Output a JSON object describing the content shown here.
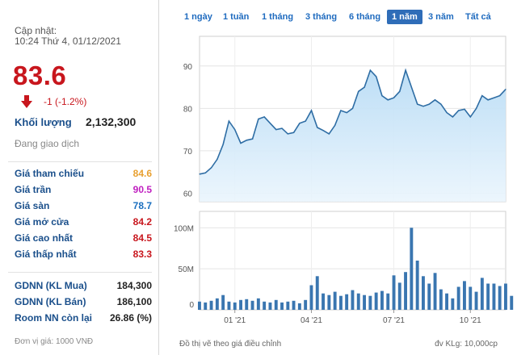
{
  "summary": {
    "updated_label": "Cập nhật:",
    "updated_time": "10:24 Thứ 4, 01/12/2021",
    "price": "83.6",
    "change": "-1 (-1.2%)",
    "volume_label": "Khối lượng",
    "volume_value": "2,132,300",
    "status": "Đang giao dịch",
    "down_color": "#c8161d"
  },
  "stats": [
    {
      "label": "Giá tham chiếu",
      "value": "84.6",
      "color": "#e8a030"
    },
    {
      "label": "Giá trần",
      "value": "90.5",
      "color": "#c020c0"
    },
    {
      "label": "Giá sàn",
      "value": "78.7",
      "color": "#1a6fbf"
    },
    {
      "label": "Giá mở cửa",
      "value": "84.2",
      "color": "#c8161d"
    },
    {
      "label": "Giá cao nhất",
      "value": "84.5",
      "color": "#c8161d"
    },
    {
      "label": "Giá thấp nhất",
      "value": "83.3",
      "color": "#c8161d"
    }
  ],
  "foreign": [
    {
      "label": "GDNN (KL Mua)",
      "value": "184,300"
    },
    {
      "label": "GDNN (KL Bán)",
      "value": "186,100"
    },
    {
      "label": "Room NN còn lại",
      "value": "26.86 (%)"
    }
  ],
  "unit_note": "Đơn vị giá: 1000 VNĐ",
  "periods": [
    "1 ngày",
    "1 tuần",
    "1 tháng",
    "3 tháng",
    "6 tháng",
    "1 năm",
    "3 năm",
    "Tất cả"
  ],
  "active_period": "1 năm",
  "footer": {
    "left": "Đồ thị vẽ theo giá điều chỉnh",
    "right": "đv KLg: 10,000cp"
  },
  "chart_data": [
    {
      "type": "area",
      "y_ticks": [
        "90",
        "80",
        "70",
        "60"
      ],
      "y_values": [
        90,
        80,
        70,
        60
      ],
      "ylim": [
        58,
        97
      ],
      "x_labels": [
        "01 '21",
        "04 '21",
        "07 '21",
        "10 '21"
      ],
      "x_label_index": [
        6,
        19,
        33,
        46
      ],
      "values": [
        64.5,
        64.8,
        66,
        68,
        71.5,
        77,
        75,
        71.8,
        72.5,
        72.8,
        77.5,
        78,
        76.5,
        75,
        75.3,
        74,
        74.3,
        76.5,
        77,
        79.5,
        75.5,
        74.8,
        74,
        76,
        79.5,
        79,
        80,
        84,
        85,
        89,
        87.5,
        83,
        82,
        82.5,
        84,
        89,
        85,
        81,
        80.5,
        81,
        82,
        81,
        79,
        78,
        79.5,
        79.8,
        78,
        80,
        83,
        82,
        82.5,
        83,
        84.5
      ],
      "line_color": "#2e6da4",
      "fill_color": "#b9dcf5",
      "grid": true
    },
    {
      "type": "bar",
      "y_ticks": [
        "100M",
        "50M",
        "0"
      ],
      "y_values": [
        100,
        50,
        0
      ],
      "ylim": [
        0,
        120
      ],
      "x_labels": [
        "01 '21",
        "04 '21",
        "07 '21",
        "10 '21"
      ],
      "x_label_index": [
        6,
        19,
        33,
        46
      ],
      "values": [
        10,
        9,
        11,
        14,
        18,
        10,
        9,
        12,
        13,
        11,
        14,
        10,
        9,
        12,
        9,
        10,
        11,
        8,
        12,
        30,
        41,
        20,
        18,
        22,
        17,
        19,
        24,
        20,
        18,
        17,
        21,
        23,
        20,
        42,
        33,
        46,
        100,
        60,
        41,
        32,
        45,
        25,
        20,
        14,
        28,
        35,
        28,
        22,
        39,
        32,
        32,
        29,
        32,
        17
      ],
      "bar_color": "#3a76b0",
      "grid": true
    }
  ]
}
